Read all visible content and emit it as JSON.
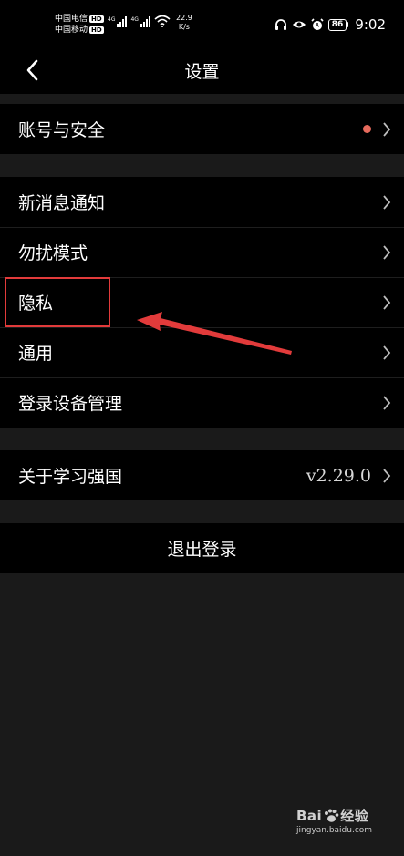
{
  "status_bar": {
    "carrier1": "中国电信",
    "carrier2": "中国移动",
    "hd_badge": "HD",
    "net1": "4G",
    "net2": "4G",
    "speed_value": "22.9",
    "speed_unit": "K/s",
    "battery": "86",
    "time": "9:02"
  },
  "header": {
    "title": "设置"
  },
  "settings": {
    "group1": [
      {
        "label": "账号与安全",
        "has_dot": true
      }
    ],
    "group2": [
      {
        "label": "新消息通知"
      },
      {
        "label": "勿扰模式"
      },
      {
        "label": "隐私"
      },
      {
        "label": "通用"
      },
      {
        "label": "登录设备管理"
      }
    ],
    "group3": [
      {
        "label": "关于学习强国",
        "value": "v2.29.0"
      }
    ]
  },
  "logout": {
    "label": "退出登录"
  },
  "watermark": {
    "brand_left": "Bai",
    "brand_right": "经验",
    "url": "jingyan.baidu.com"
  },
  "colors": {
    "background": "#1a1a1a",
    "row_background": "#000000",
    "text": "#ffffff",
    "dot": "#e66a5c",
    "annotation": "#e23b3b"
  }
}
